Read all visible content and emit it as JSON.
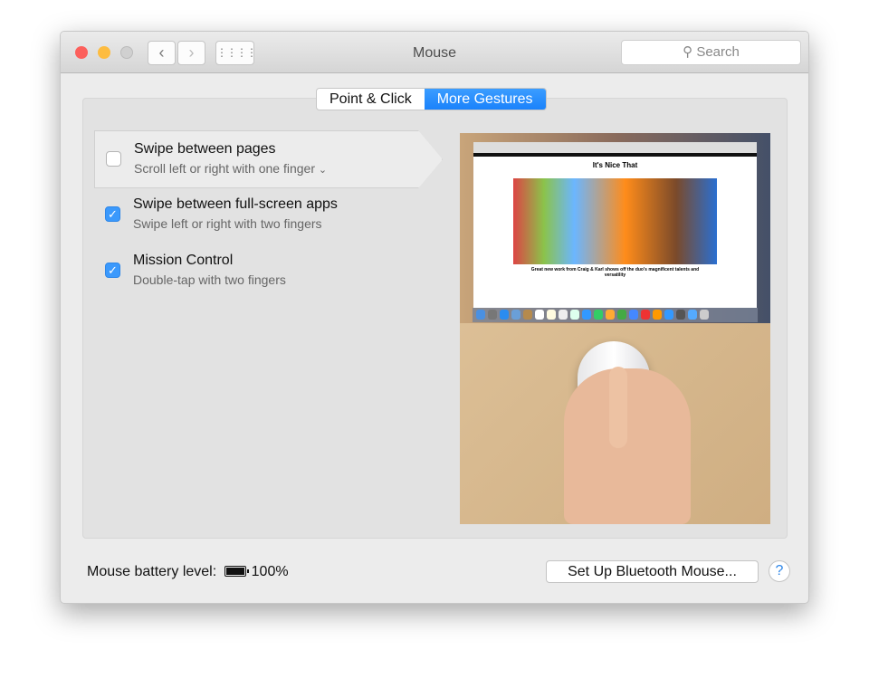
{
  "window": {
    "title": "Mouse",
    "search_placeholder": "Search"
  },
  "tabs": [
    {
      "label": "Point & Click",
      "active": false
    },
    {
      "label": "More Gestures",
      "active": true
    }
  ],
  "gestures": [
    {
      "label": "Swipe between pages",
      "detail": "Scroll left or right with one finger",
      "checked": false,
      "selected": true
    },
    {
      "label": "Swipe between full-screen apps",
      "detail": "Swipe left or right with two fingers",
      "checked": true
    },
    {
      "label": "Mission Control",
      "detail": "Double-tap with two fingers",
      "checked": true
    }
  ],
  "preview": {
    "site_title": "It's Nice That",
    "headline": "Great new work from Craig & Karl shows off the duo's magnificent talents and versatility"
  },
  "footer": {
    "battery_label": "Mouse battery level:",
    "battery_level": "100%",
    "battery_fraction": 1.0,
    "setup_button": "Set Up Bluetooth Mouse...",
    "help": "?"
  },
  "colors": {
    "accent": "#1a82fb",
    "close": "#fc605c",
    "minimize": "#fdbc40"
  }
}
